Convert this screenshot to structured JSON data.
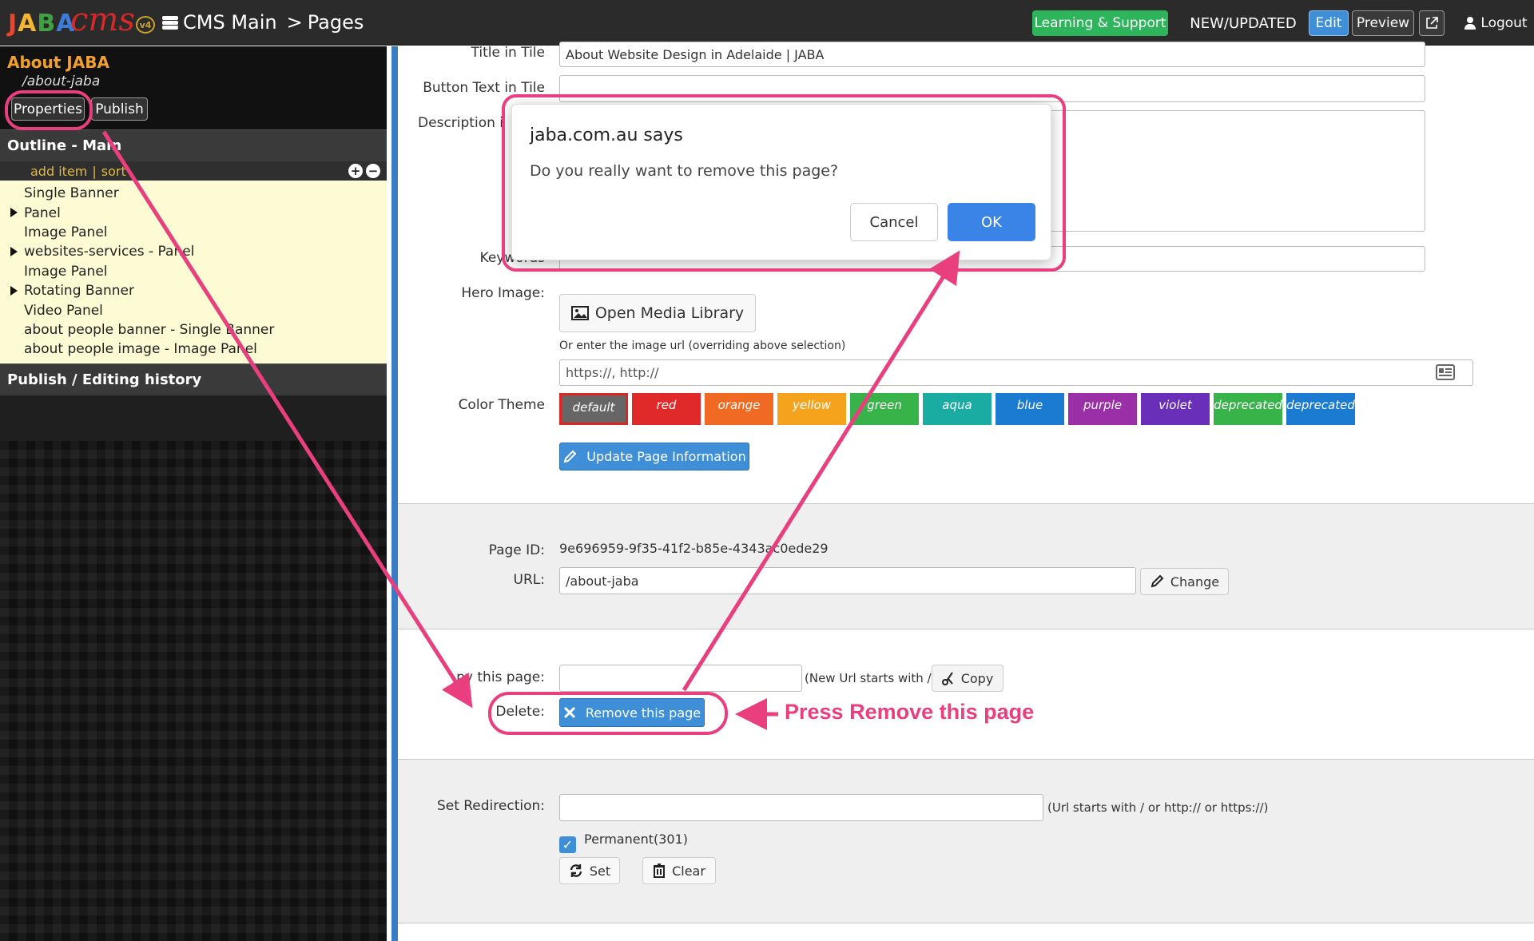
{
  "topbar": {
    "logo_text_j": "J",
    "logo_text_a1": "A",
    "logo_text_b": "B",
    "logo_text_a2": "A",
    "logo_script": "cms",
    "logo_version": "v4",
    "breadcrumb_root": "CMS Main",
    "breadcrumb_sep": ">",
    "breadcrumb_page": "Pages",
    "learning_label": "Learning & Support",
    "new_updated_label": "NEW/UPDATED",
    "edit_label": "Edit",
    "preview_label": "Preview",
    "logout_label": "Logout"
  },
  "sidebar": {
    "page_title": "About JABA",
    "page_path": "/about-jaba",
    "tab_properties": "Properties",
    "tab_publish": "Publish",
    "outline_title": "Outline - Main",
    "add_item": "add item",
    "add_sep": "|",
    "sort": "sort",
    "outline_items": [
      {
        "label": "Single Banner",
        "expandable": false
      },
      {
        "label": "Panel",
        "expandable": true
      },
      {
        "label": "Image Panel",
        "expandable": false
      },
      {
        "label": "websites-services - Panel",
        "expandable": true
      },
      {
        "label": "Image Panel",
        "expandable": false
      },
      {
        "label": "Rotating Banner",
        "expandable": true
      },
      {
        "label": "Video Panel",
        "expandable": false
      },
      {
        "label": "about people banner - Single Banner",
        "expandable": false
      },
      {
        "label": "about people image - Image Panel",
        "expandable": false
      }
    ],
    "history_title": "Publish / Editing history"
  },
  "form": {
    "title_in_tile_label": "Title in Tile",
    "title_in_tile_value": "About Website Design in Adelaide | JABA",
    "button_text_label": "Button Text in Tile",
    "button_text_value": "",
    "description_label": "Description i",
    "keywords_label": "Keywords",
    "hero_image_label": "Hero Image:",
    "open_media_label": "Open Media Library",
    "url_hint": "Or enter the image url (overriding above selection)",
    "image_url_placeholder": "https://, http://",
    "color_theme_label": "Color Theme",
    "color_themes": [
      {
        "name": "default",
        "color": "#666666",
        "selected": true
      },
      {
        "name": "red",
        "color": "#e02a2a",
        "selected": false
      },
      {
        "name": "orange",
        "color": "#f06a24",
        "selected": false
      },
      {
        "name": "yellow",
        "color": "#f5a31c",
        "selected": false
      },
      {
        "name": "green",
        "color": "#37b34a",
        "selected": false
      },
      {
        "name": "aqua",
        "color": "#1aaba3",
        "selected": false
      },
      {
        "name": "blue",
        "color": "#1a7bd0",
        "selected": false
      },
      {
        "name": "purple",
        "color": "#9a2fa8",
        "selected": false
      },
      {
        "name": "violet",
        "color": "#6a2fb8",
        "selected": false
      },
      {
        "name": "deprecated",
        "color": "#37b34a",
        "selected": false
      },
      {
        "name": "deprecated",
        "color": "#1a7bd0",
        "selected": false
      }
    ],
    "update_label": "Update Page Information"
  },
  "page_info": {
    "page_id_label": "Page ID:",
    "page_id_value": "9e696959-9f35-41f2-b85e-4343ac0ede29",
    "url_label": "URL:",
    "url_value": "/about-jaba",
    "change_label": "Change"
  },
  "actions": {
    "copy_label": "py this page:",
    "copy_hint": "(New Url starts with /)",
    "copy_button": "Copy",
    "delete_label": "Delete:",
    "remove_button": "Remove this page"
  },
  "redirect": {
    "label": "Set Redirection:",
    "hint": "(Url starts with / or http:// or https://)",
    "permanent_label": "Permanent(301)",
    "permanent_checked": true,
    "set_label": "Set",
    "clear_label": "Clear"
  },
  "dialog": {
    "title": "jaba.com.au says",
    "message": "Do you really want to remove this page?",
    "cancel": "Cancel",
    "ok": "OK"
  },
  "annotation": {
    "text": "Press Remove this page",
    "color": "#ea3f7f"
  }
}
